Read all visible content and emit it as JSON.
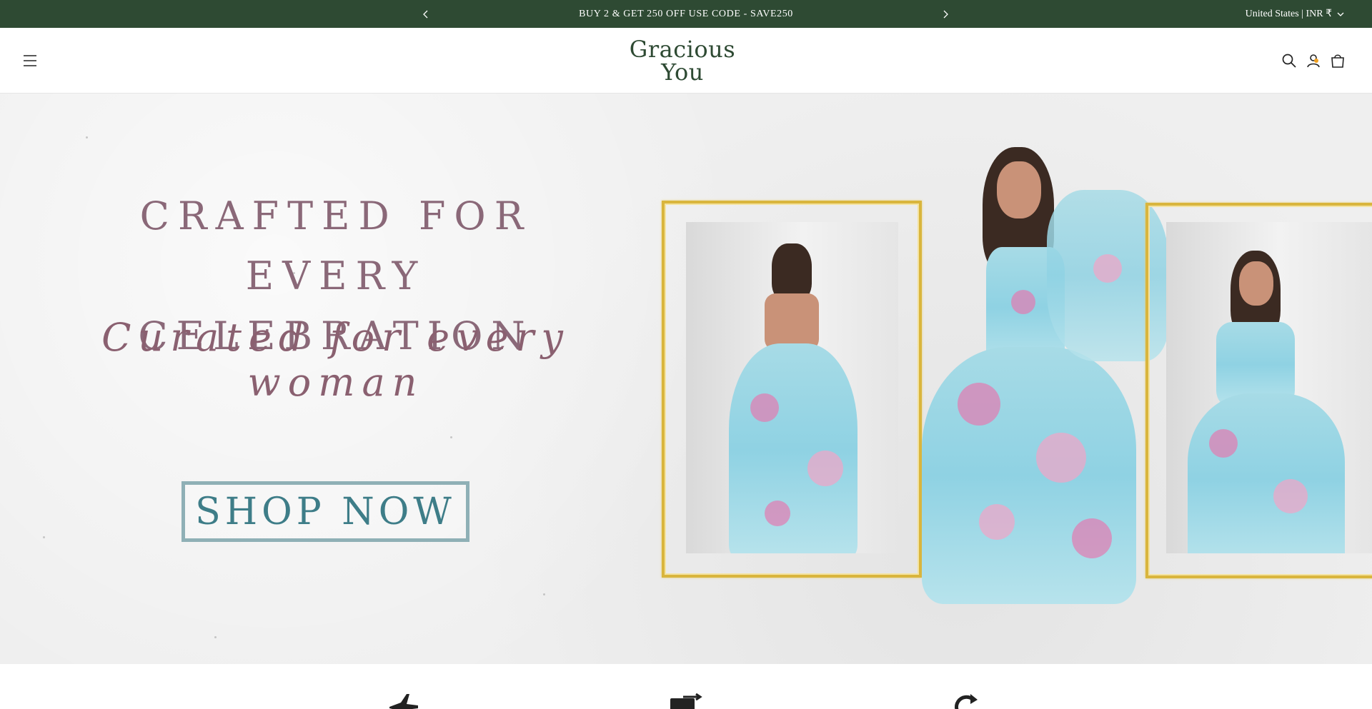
{
  "announcement": {
    "message": "BUY 2 & GET 250 OFF USE CODE - SAVE250",
    "prev_icon": "chevron-left-icon",
    "next_icon": "chevron-right-icon",
    "locale_label": "United States | INR ₹",
    "background_color": "#2e4a33"
  },
  "header": {
    "menu_icon": "hamburger-icon",
    "logo_line1": "Gracious",
    "logo_line2": "You",
    "logo_color": "#2e4a33",
    "icons": [
      "search-icon",
      "account-icon",
      "cart-icon"
    ]
  },
  "hero": {
    "headline_line1": "CRAFTED FOR EVERY",
    "headline_line2": "CELEBRATION",
    "tagline": "Curated for every woman",
    "cta_label": "SHOP NOW",
    "headline_color": "#8a6878",
    "cta_color": "#3e7d88",
    "frame_color": "#d9b53d"
  },
  "features": {
    "icons": [
      "airplane-icon",
      "payment-card-icon",
      "refresh-icon"
    ]
  }
}
